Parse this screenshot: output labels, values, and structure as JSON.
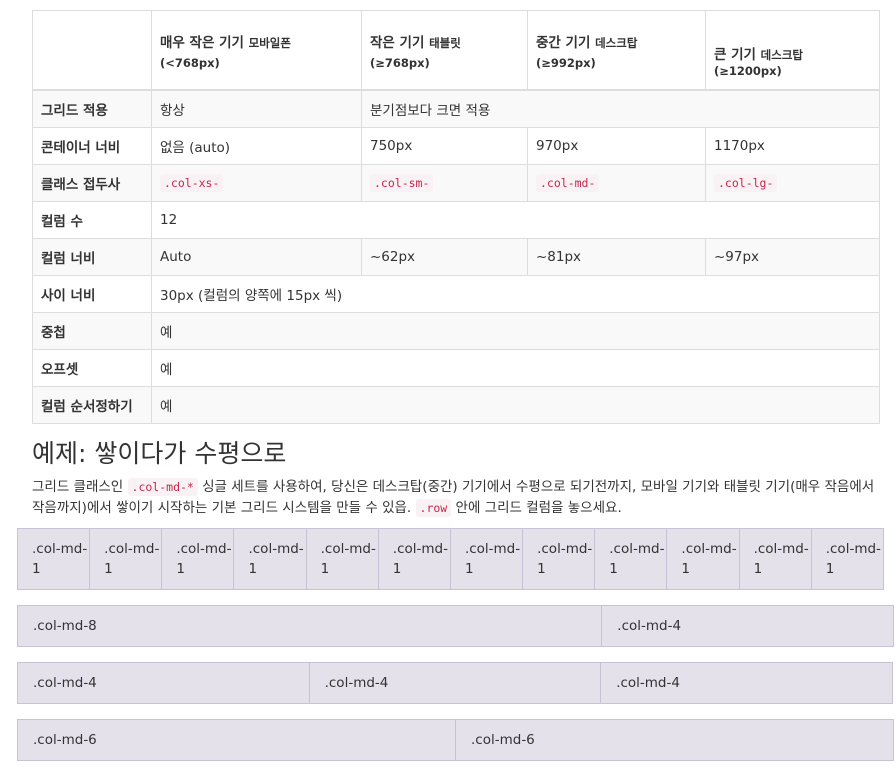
{
  "table": {
    "headers": [
      {
        "main": "",
        "sub": "",
        "range": ""
      },
      {
        "main": "매우 작은 기기",
        "sub": "모바일폰",
        "range": "(<768px)"
      },
      {
        "main": "작은 기기",
        "sub": "태블릿",
        "range": "(≥768px)"
      },
      {
        "main": "중간 기기",
        "sub": "데스크탑",
        "range": "(≥992px)"
      },
      {
        "main": "큰 기기",
        "sub": "데스크탑",
        "range": "(≥1200px)"
      }
    ],
    "rows": {
      "grid": {
        "label": "그리드 적용",
        "xs": "항상",
        "rest": "분기점보다 크면 적용"
      },
      "container": {
        "label": "콘테이너 너비",
        "xs": "없음 (auto)",
        "sm": "750px",
        "md": "970px",
        "lg": "1170px"
      },
      "prefix": {
        "label": "클래스 접두사",
        "xs": ".col-xs-",
        "sm": ".col-sm-",
        "md": ".col-md-",
        "lg": ".col-lg-"
      },
      "columns": {
        "label": "컬럼 수",
        "value": "12"
      },
      "colwidth": {
        "label": "컬럼 너비",
        "xs": "Auto",
        "sm": "~62px",
        "md": "~81px",
        "lg": "~97px"
      },
      "gutter": {
        "label": "사이 너비",
        "value": "30px (컬럼의 양쪽에 15px 씩)"
      },
      "nesting": {
        "label": "중첩",
        "value": "예"
      },
      "offsets": {
        "label": "오프셋",
        "value": "예"
      },
      "ordering": {
        "label": "컬럼 순서정하기",
        "value": "예"
      }
    }
  },
  "example": {
    "title": "예제: 쌓이다가 수평으로",
    "desc_1": "그리드 클래스인 ",
    "desc_code_1": ".col-md-*",
    "desc_2": " 싱글 세트를 사용하여, 당신은 데스크탑(중간) 기기에서 수평으로 되기전까지, 모바일 기기와 태블릿 기기(매우 작음에서 작음까지)에서 쌓이기 시작하는 기본 그리드 시스템을 만들 수 있읍. ",
    "desc_code_2": ".row",
    "desc_3": " 안에 그리드 컬럼을 놓으세요."
  },
  "demo": {
    "row1": [
      ".col-md-1",
      ".col-md-1",
      ".col-md-1",
      ".col-md-1",
      ".col-md-1",
      ".col-md-1",
      ".col-md-1",
      ".col-md-1",
      ".col-md-1",
      ".col-md-1",
      ".col-md-1",
      ".col-md-1"
    ],
    "row2": [
      ".col-md-8",
      ".col-md-4"
    ],
    "row3": [
      ".col-md-4",
      ".col-md-4",
      ".col-md-4"
    ],
    "row4": [
      ".col-md-6",
      ".col-md-6"
    ]
  }
}
